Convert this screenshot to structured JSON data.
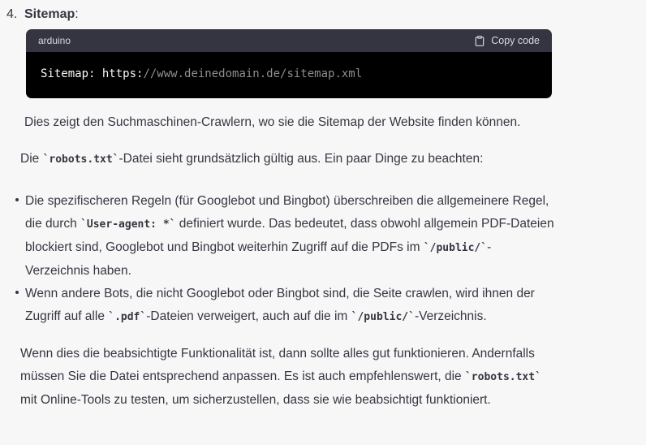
{
  "theme": {
    "page_bg": "#f7f7f8",
    "text_color": "#353740",
    "code_header_bg": "#343541",
    "code_header_text": "#d9d9e3",
    "code_bg": "#000000",
    "code_text": "#f8f8f2",
    "code_comment": "#8e8e8e"
  },
  "list_heading": {
    "number": "4.",
    "title": "Sitemap",
    "suffix": ":"
  },
  "code_block": {
    "language_label": "arduino",
    "copy_button_label": "Copy code",
    "copy_icon": "clipboard-icon",
    "code_segments": [
      {
        "text": "Sitemap: https:"
      },
      {
        "text": "//www.deinedomain.de/sitemap.xml",
        "comment": true
      }
    ]
  },
  "content": {
    "p1": [
      "Dies zeigt den Suchmaschinen-Crawlern, wo sie die Sitemap der Website finden können."
    ],
    "p2": [
      "Die ",
      {
        "code": "`robots.txt`"
      },
      "-Datei sieht grundsätzlich gültig aus. Ein paar Dinge zu beachten:"
    ],
    "bullets": [
      [
        "Die spezifischeren Regeln (für Googlebot und Bingbot) überschreiben die allgemeinere Regel, die durch ",
        {
          "code": "`User-agent: *`"
        },
        " definiert wurde. Das bedeutet, dass obwohl allgemein PDF-Dateien blockiert sind, Googlebot und Bingbot weiterhin Zugriff auf die PDFs im ",
        {
          "code": "`/public/`"
        },
        "-Verzeichnis haben."
      ],
      [
        "Wenn andere Bots, die nicht Googlebot oder Bingbot sind, die Seite crawlen, wird ihnen der Zugriff auf alle ",
        {
          "code": "`.pdf`"
        },
        "-Dateien verweigert, auch auf die im ",
        {
          "code": "`/public/`"
        },
        "-Verzeichnis."
      ]
    ],
    "p3": [
      "Wenn dies die beabsichtigte Funktionalität ist, dann sollte alles gut funktionieren. Andernfalls müssen Sie die Datei entsprechend anpassen. Es ist auch empfehlenswert, die ",
      {
        "code": "`robots.txt`"
      },
      " mit Online-Tools zu testen, um sicherzustellen, dass sie wie beabsichtigt funktioniert."
    ]
  }
}
